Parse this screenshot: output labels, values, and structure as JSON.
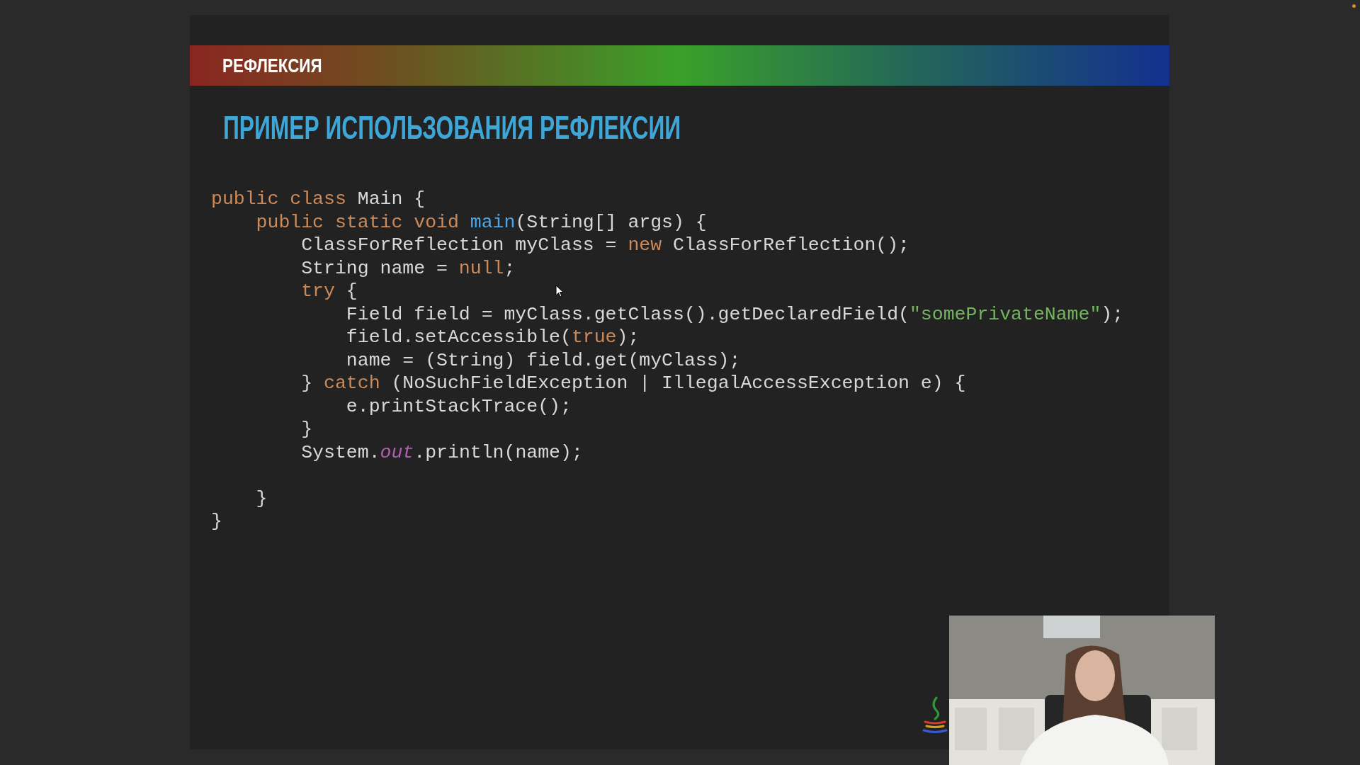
{
  "slide": {
    "section": "РЕФЛЕКСИЯ",
    "title": "ПРИМЕР ИСПОЛЬЗОВАНИЯ РЕФЛЕКСИИ",
    "code": [
      {
        "tokens": [
          {
            "text": "public class ",
            "kind": "keyword"
          },
          {
            "text": "Main {",
            "kind": "plain"
          }
        ]
      },
      {
        "tokens": [
          {
            "text": "    public static void ",
            "kind": "keyword"
          },
          {
            "text": "main",
            "kind": "method"
          },
          {
            "text": "(String[] args) {",
            "kind": "plain"
          }
        ]
      },
      {
        "tokens": [
          {
            "text": "        ClassForReflection myClass = ",
            "kind": "plain"
          },
          {
            "text": "new ",
            "kind": "keyword"
          },
          {
            "text": "ClassForReflection();",
            "kind": "plain"
          }
        ]
      },
      {
        "tokens": [
          {
            "text": "        String name = ",
            "kind": "plain"
          },
          {
            "text": "null",
            "kind": "keyword"
          },
          {
            "text": ";",
            "kind": "plain"
          }
        ]
      },
      {
        "tokens": [
          {
            "text": "        try ",
            "kind": "keyword"
          },
          {
            "text": "{",
            "kind": "plain"
          }
        ]
      },
      {
        "tokens": [
          {
            "text": "            Field field = myClass.getClass().getDeclaredField(",
            "kind": "plain"
          },
          {
            "text": "\"somePrivateName\"",
            "kind": "string"
          },
          {
            "text": ");",
            "kind": "plain"
          }
        ]
      },
      {
        "tokens": [
          {
            "text": "            field.setAccessible(",
            "kind": "plain"
          },
          {
            "text": "true",
            "kind": "keyword"
          },
          {
            "text": ");",
            "kind": "plain"
          }
        ]
      },
      {
        "tokens": [
          {
            "text": "            name = (String) field.get(myClass);",
            "kind": "plain"
          }
        ]
      },
      {
        "tokens": [
          {
            "text": "        } ",
            "kind": "plain"
          },
          {
            "text": "catch ",
            "kind": "keyword"
          },
          {
            "text": "(NoSuchFieldException | IllegalAccessException e) {",
            "kind": "plain"
          }
        ]
      },
      {
        "tokens": [
          {
            "text": "            e.printStackTrace();",
            "kind": "plain"
          }
        ]
      },
      {
        "tokens": [
          {
            "text": "        }",
            "kind": "plain"
          }
        ]
      },
      {
        "tokens": [
          {
            "text": "        System.",
            "kind": "plain"
          },
          {
            "text": "out",
            "kind": "field"
          },
          {
            "text": ".println(name);",
            "kind": "plain"
          }
        ]
      },
      {
        "gap_before": true,
        "tokens": [
          {
            "text": "    }",
            "kind": "plain"
          }
        ]
      },
      {
        "tokens": [
          {
            "text": "}",
            "kind": "plain"
          }
        ]
      }
    ]
  }
}
